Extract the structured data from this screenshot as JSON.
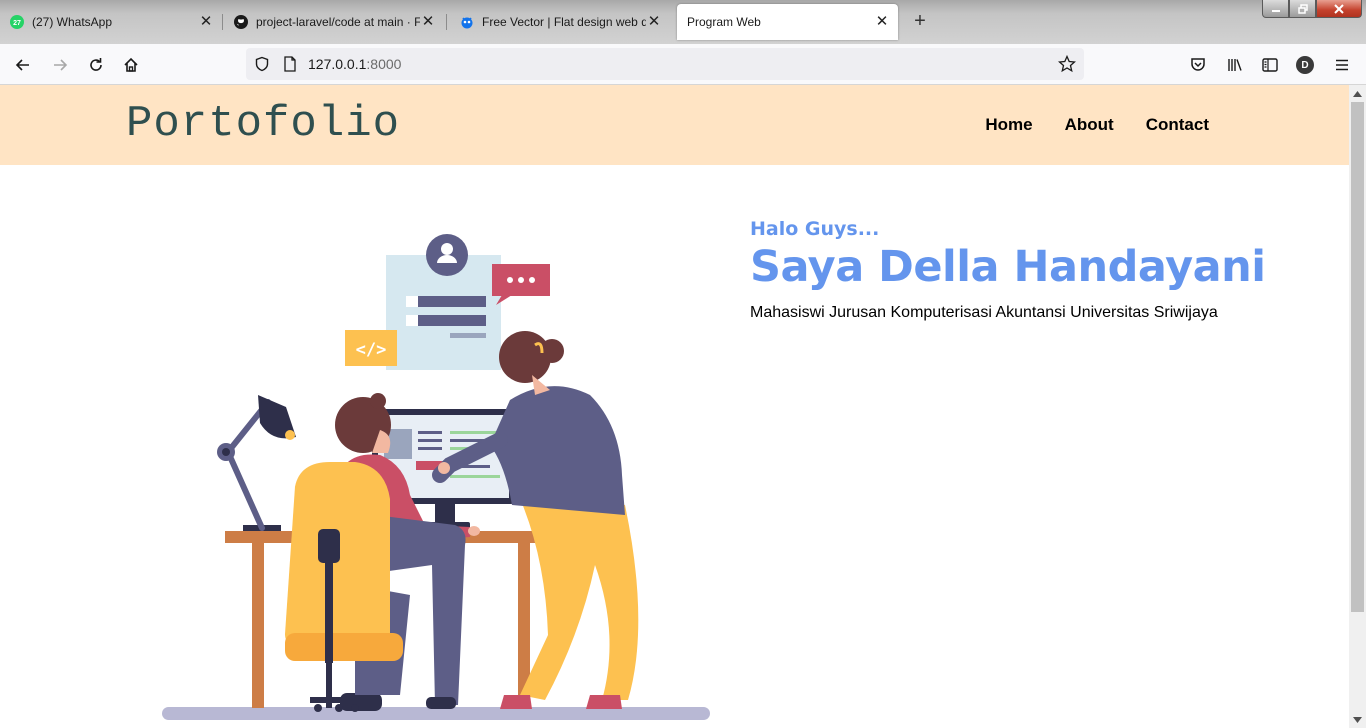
{
  "browser": {
    "tabs": [
      {
        "label": "(27) WhatsApp",
        "icon": "whatsapp-icon",
        "badge": "27"
      },
      {
        "label": "project-laravel/code at main · F",
        "icon": "github-icon"
      },
      {
        "label": "Free Vector | Flat design web de",
        "icon": "freepik-icon"
      },
      {
        "label": "Program Web",
        "icon": "",
        "active": true
      }
    ],
    "new_tab": "+",
    "url_host": "127.0.0.1",
    "url_port": ":8000",
    "profile_initial": "D"
  },
  "site": {
    "logo": "Portofolio",
    "menu": [
      "Home",
      "About",
      "Contact"
    ],
    "greeting": "Halo Guys...",
    "name": "Saya Della Handayani",
    "description": "Mahasiswi Jurusan Komputerisasi Akuntansi Universitas Sriwijaya"
  },
  "colors": {
    "header_bg": "#ffe4c4",
    "logo": "#2f4f4f",
    "accent": "#6495ed"
  }
}
